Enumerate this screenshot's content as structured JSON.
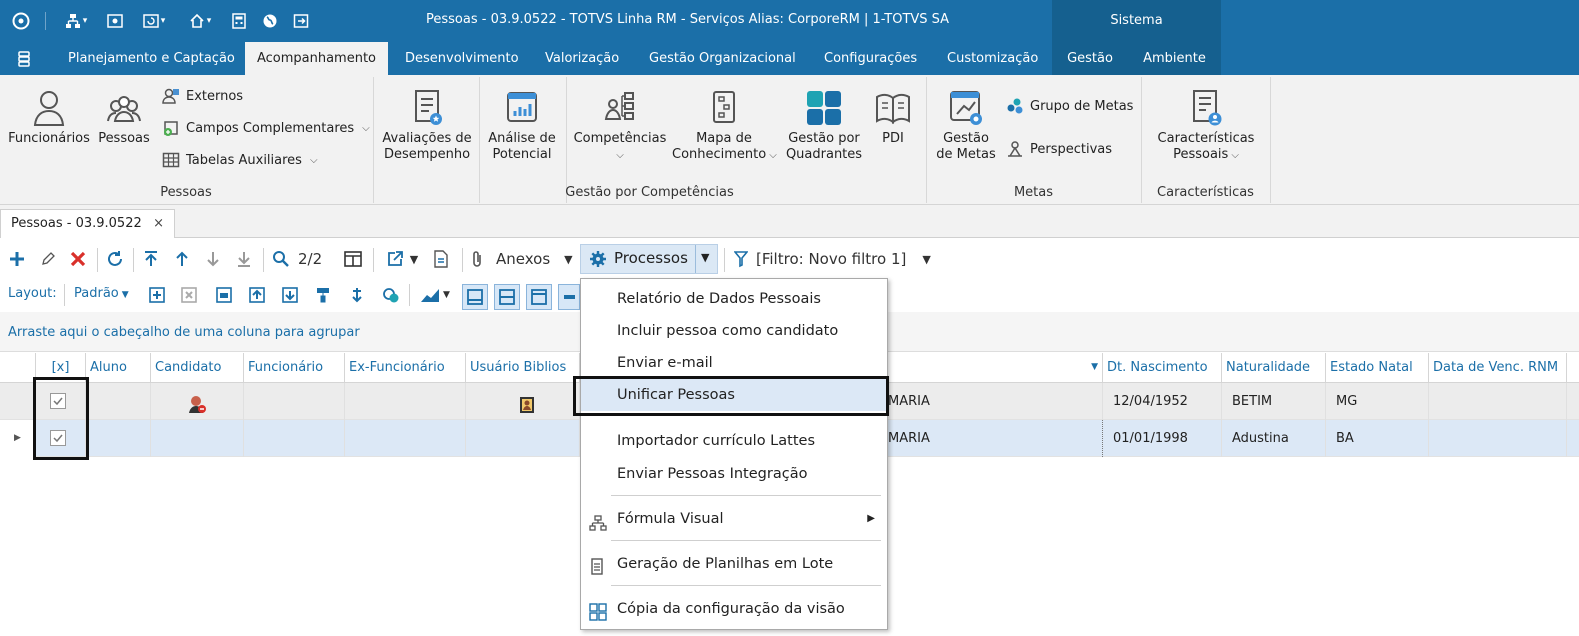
{
  "window": {
    "title": "Pessoas - 03.9.0522 - TOTVS Linha RM - Serviços  Alias: CorporeRM | 1-TOTVS SA",
    "sistema": "Sistema"
  },
  "menu": {
    "tabs": [
      "Planejamento e Captação",
      "Acompanhamento",
      "Desenvolvimento",
      "Valorização",
      "Gestão Organizacional",
      "Configurações",
      "Customização",
      "Gestão",
      "Ambiente"
    ]
  },
  "ribbon": {
    "funcionarios": "Funcionários",
    "pessoas": "Pessoas",
    "externos": "Externos",
    "campos_complementares": "Campos Complementares",
    "tabelas_auxiliares": "Tabelas Auxiliares",
    "group_pessoas": "Pessoas",
    "avaliacoes_l1": "Avaliações de",
    "avaliacoes_l2": "Desempenho",
    "analise_l1": "Análise de",
    "analise_l2": "Potencial",
    "competencias": "Competências",
    "mapa_l1": "Mapa de",
    "mapa_l2": "Conhecimento",
    "gestao_quad_l1": "Gestão por",
    "gestao_quad_l2": "Quadrantes",
    "pdi": "PDI",
    "group_competencias": "Gestão por Competências",
    "gestao_metas_l1": "Gestão",
    "gestao_metas_l2": "de Metas",
    "grupo_metas": "Grupo de Metas",
    "perspectivas": "Perspectivas",
    "group_metas": "Metas",
    "caracteristicas_l1": "Características",
    "caracteristicas_l2": "Pessoais",
    "group_caracteristicas": "Características"
  },
  "doc_tab": {
    "label": "Pessoas - 03.9.0522",
    "close": "×"
  },
  "toolbar": {
    "page_counter": "2/2",
    "anexos": "Anexos",
    "processos": "Processos",
    "filtro": "[Filtro: Novo filtro 1]",
    "layout_label": "Layout:",
    "layout_value": "Padrão"
  },
  "grouping_hint": "Arraste aqui o cabeçalho de uma coluna para agrupar",
  "grid": {
    "headers": {
      "select": "[x]",
      "aluno": "Aluno",
      "candidato": "Candidato",
      "funcionario": "Funcionário",
      "ex_funcionario": "Ex-Funcionário",
      "usuario_biblios": "Usuário Biblios",
      "dt_nascimento": "Dt. Nascimento",
      "naturalidade": "Naturalidade",
      "estado_natal": "Estado Natal",
      "data_venc_rnm": "Data de Venc. RNM"
    },
    "rows": [
      {
        "nome": "MARIA",
        "dt_nascimento": "12/04/1952",
        "naturalidade": "BETIM",
        "estado_natal": "MG"
      },
      {
        "nome": "MARIA",
        "dt_nascimento": "01/01/1998",
        "naturalidade": "Adustina",
        "estado_natal": "BA"
      }
    ]
  },
  "processos_menu": {
    "items": [
      "Relatório de Dados Pessoais",
      "Incluir pessoa como candidato",
      "Enviar e-mail",
      "Unificar Pessoas",
      "Importador currículo Lattes",
      "Enviar Pessoas Integração",
      "Fórmula Visual",
      "Geração de Planilhas em Lote",
      "Cópia da configuração da visão"
    ]
  },
  "colors": {
    "brand": "#1b6fa8",
    "brand_dark": "#15608f",
    "selected_row": "#dce8f6",
    "delete_red": "#d9302a"
  }
}
